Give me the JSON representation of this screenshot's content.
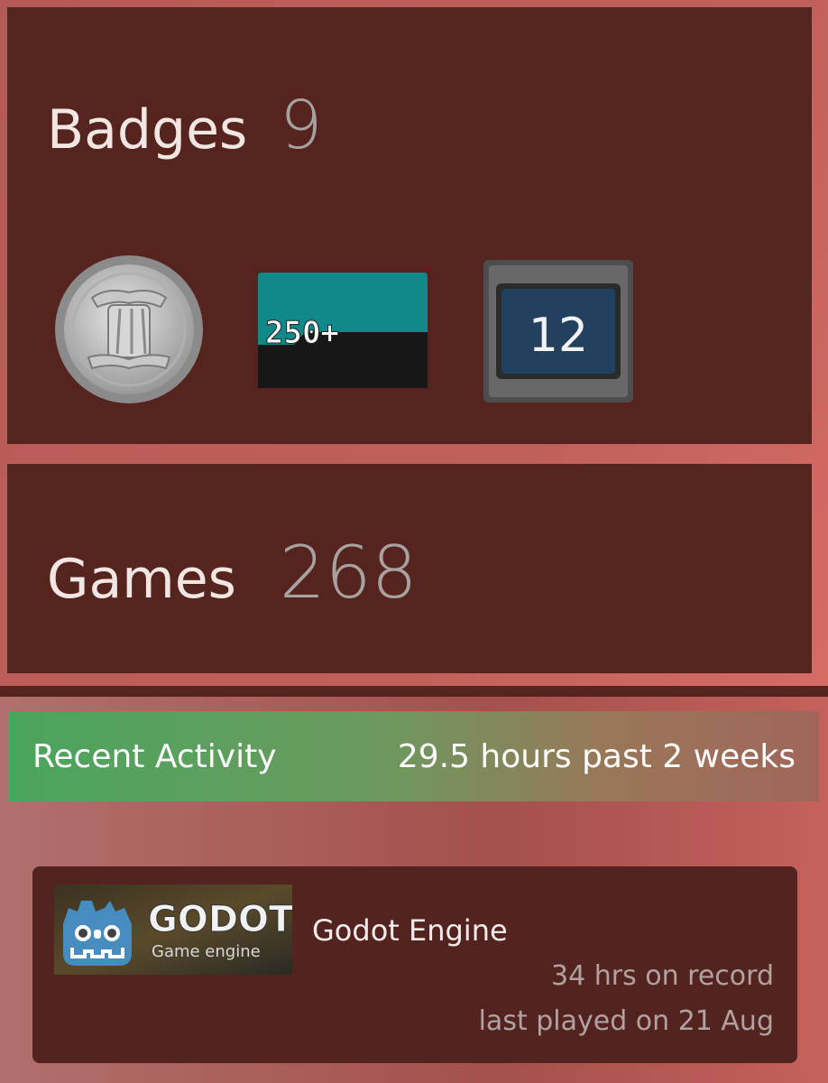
{
  "badges": {
    "label": "Badges",
    "count": "9",
    "icons": [
      "pillar-coin-badge-icon",
      "250-plus-badge-icon",
      "level-12-badge-icon"
    ],
    "badge_250_text": "250+",
    "badge_level_text": "12"
  },
  "games": {
    "label": "Games",
    "count": "268"
  },
  "recent_activity": {
    "title": "Recent Activity",
    "summary": "29.5 hours past 2 weeks",
    "colors": {
      "header_start": "#4aa55c",
      "header_end": "#a0665a"
    },
    "items": [
      {
        "logo_title": "GODOT",
        "logo_subtitle": "Game engine",
        "name": "Godot Engine",
        "hours": "34 hrs on record",
        "last_played": "last played on 21 Aug"
      }
    ]
  }
}
